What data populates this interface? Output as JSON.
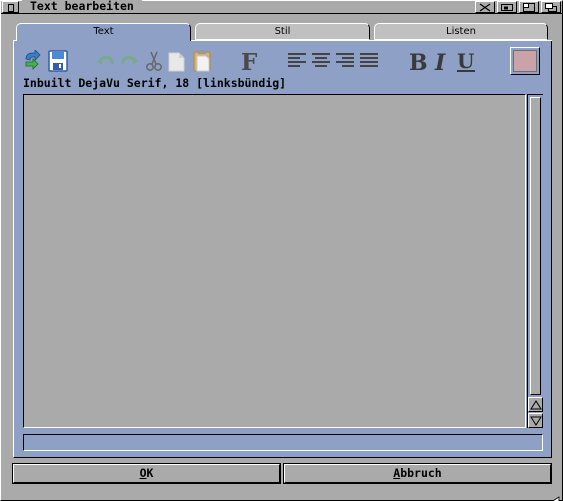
{
  "window": {
    "title": "Text bearbeiten"
  },
  "tabs": [
    {
      "label": "Text",
      "active": true
    },
    {
      "label": "Stil",
      "active": false
    },
    {
      "label": "Listen",
      "active": false
    }
  ],
  "toolbar": {
    "font_button_glyph": "F",
    "bold_glyph": "B",
    "italic_glyph": "I",
    "underline_glyph": "U",
    "icons": [
      "new-document-icon",
      "save-disk-icon",
      "undo-icon",
      "redo-icon",
      "cut-scissors-icon",
      "copy-icon",
      "paste-icon",
      "font-icon",
      "align-left-icon",
      "align-center-icon",
      "align-right-icon",
      "justify-icon",
      "bold-icon",
      "italic-icon",
      "underline-icon",
      "color-swatch-icon"
    ],
    "color_swatch": "#c9a3a8"
  },
  "status": {
    "font_info": "Inbuilt DejaVu Serif, 18 [linksbündig]"
  },
  "editor": {
    "text": ""
  },
  "info_field": {
    "text": ""
  },
  "buttons": {
    "ok": {
      "label_key": "O",
      "label_rest": "K"
    },
    "cancel": {
      "label_key": "A",
      "label_rest": "bbruch"
    }
  },
  "colors": {
    "panel": "#8ea0c6",
    "background": "#aaaaaa",
    "highlight": "#ffffff",
    "shadow": "#000000"
  }
}
